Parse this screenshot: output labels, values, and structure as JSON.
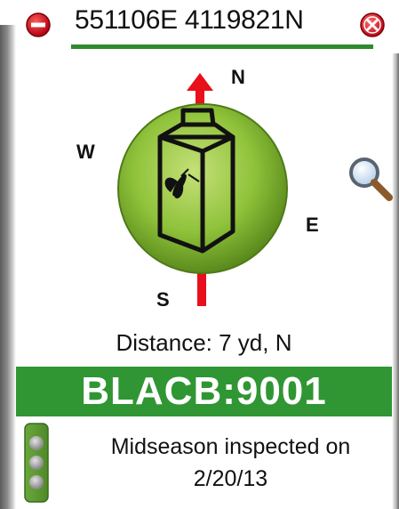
{
  "header": {
    "coordinates": "551106E 4119821N",
    "remove_icon": "minus-circle-icon",
    "close_icon": "close-circle-icon"
  },
  "compass": {
    "north": "N",
    "south": "S",
    "east": "E",
    "west": "W",
    "center_icon": "trap-carton-icon",
    "zoom_icon": "magnifier-icon"
  },
  "distance": "Distance: 7 yd, N",
  "trap_id": "BLACB:9001",
  "status": {
    "line1": "Midseason inspected on",
    "line2": "2/20/13",
    "indicator_icon": "traffic-light-icon"
  },
  "colors": {
    "accent_green": "#2f9633",
    "arrow_red": "#e8101a",
    "compass_green": "#8fc23a",
    "remove_red": "#d01020"
  }
}
